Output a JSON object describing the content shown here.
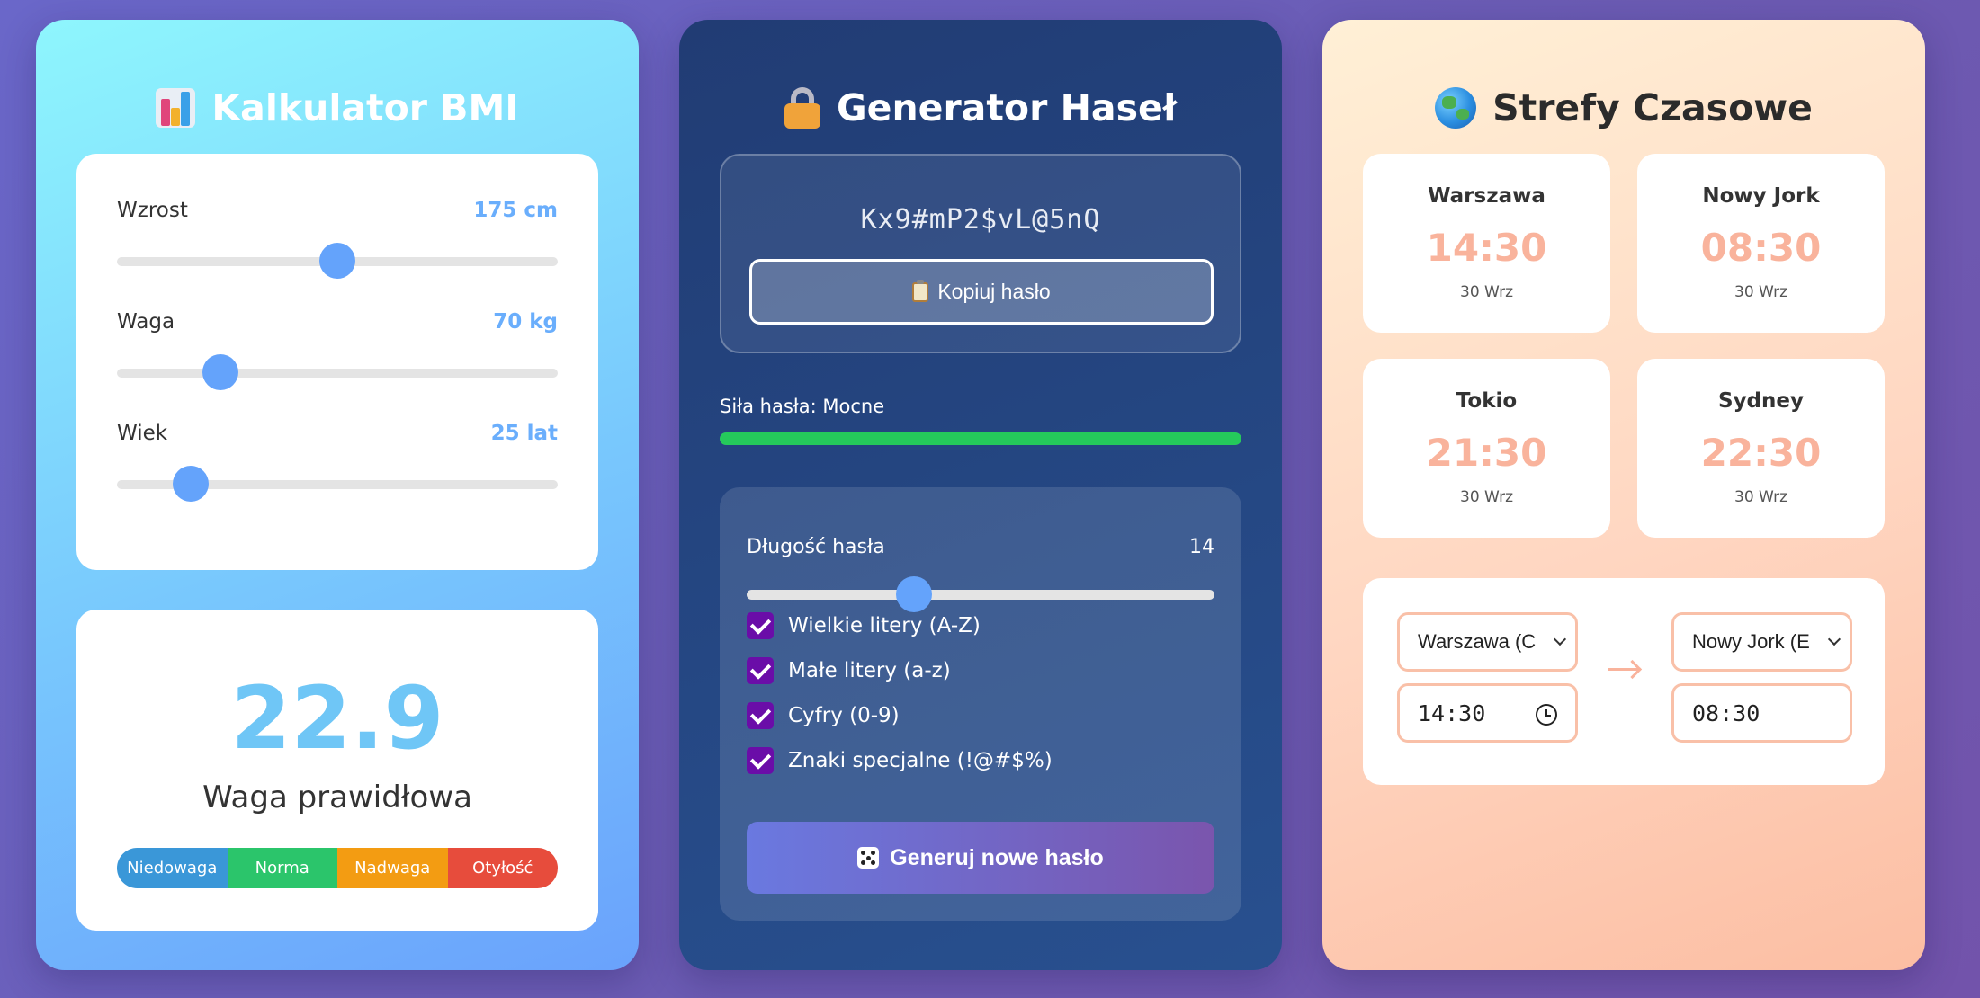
{
  "bmi": {
    "title": "Kalkulator BMI",
    "title_icon": "bar-chart-icon",
    "sliders": [
      {
        "label": "Wzrost",
        "value_text": "175 cm",
        "value": 175,
        "min": 100,
        "max": 250
      },
      {
        "label": "Waga",
        "value_text": "70 kg",
        "value": 70,
        "min": 30,
        "max": 200
      },
      {
        "label": "Wiek",
        "value_text": "25 lat",
        "value": 25,
        "min": 10,
        "max": 100
      }
    ],
    "result_value": "22.9",
    "result_status": "Waga prawidłowa",
    "scale": [
      {
        "label": "Niedowaga",
        "color": "#3a97d8"
      },
      {
        "label": "Norma",
        "color": "#2bc56b"
      },
      {
        "label": "Nadwaga",
        "color": "#f39c12"
      },
      {
        "label": "Otyłość",
        "color": "#e74c3c"
      }
    ],
    "accent_color": "#6aaefc"
  },
  "password": {
    "title": "Generator Haseł",
    "title_icon": "lock-icon",
    "generated": "Kx9#mP2$vL@5nQ",
    "copy_label": "Kopiuj hasło",
    "strength_label": "Siła hasła: Mocne",
    "strength_fraction": 1.0,
    "strength_color": "#25c95b",
    "length_label": "Długość hasła",
    "length_value": "14",
    "length_num": 14,
    "length_min": 4,
    "length_max": 32,
    "options": [
      {
        "label": "Wielkie litery (A-Z)",
        "checked": true
      },
      {
        "label": "Małe litery (a-z)",
        "checked": true
      },
      {
        "label": "Cyfry (0-9)",
        "checked": true
      },
      {
        "label": "Znaki specjalne (!@#$%)",
        "checked": true
      }
    ],
    "generate_label": "Generuj nowe hasło"
  },
  "timezones": {
    "title": "Strefy Czasowe",
    "title_icon": "globe-icon",
    "cities": [
      {
        "city": "Warszawa",
        "time": "14:30",
        "date": "30 Wrz"
      },
      {
        "city": "Nowy Jork",
        "time": "08:30",
        "date": "30 Wrz"
      },
      {
        "city": "Tokio",
        "time": "21:30",
        "date": "30 Wrz"
      },
      {
        "city": "Sydney",
        "time": "22:30",
        "date": "30 Wrz"
      }
    ],
    "converter": {
      "from_zone": "Warszawa (C",
      "to_zone": "Nowy Jork (E",
      "from_time": "14:30",
      "to_time": "08:30"
    },
    "accent_color": "#f9b39c"
  }
}
